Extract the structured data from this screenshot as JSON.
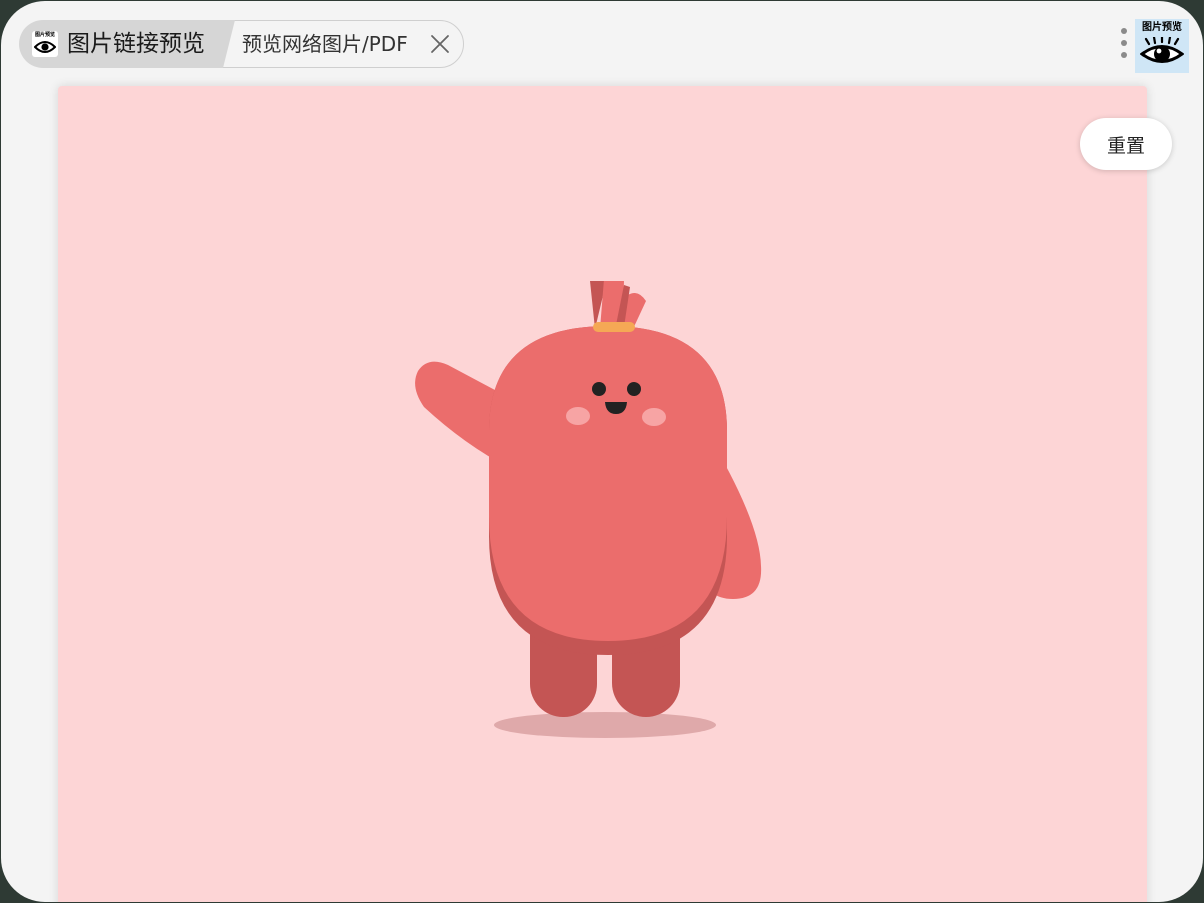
{
  "header": {
    "app_tab": {
      "logo_text": "图片预览",
      "title": "图片链接预览"
    },
    "page_tab": {
      "label": "预览网络图片/PDF",
      "close_icon": "close-icon"
    },
    "menu_icon": "more-vertical-icon",
    "extension": {
      "label": "图片预览",
      "icon": "eye-icon"
    }
  },
  "content": {
    "background_color": "#fdd5d6",
    "image_subject": "mascot-illustration",
    "reset_label": "重置"
  },
  "colors": {
    "body": "#eb6d6c",
    "body_shadow": "#c45554",
    "cheek": "#f7a4a4",
    "band": "#f5a855",
    "ground_shadow": "#dfa9aa"
  }
}
